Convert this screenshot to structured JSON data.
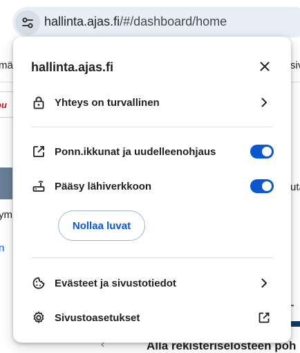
{
  "address_bar": {
    "url_host": "hallinta.ajas.fi",
    "url_rest": "/#/dashboard/home",
    "site_info_icon": "tune-icon"
  },
  "background_page": {
    "nav_left": "mä",
    "nav_right": "siv",
    "text_ym": "ym",
    "text_n": "n",
    "text_uta": "uta",
    "text_T": "T",
    "bottom_heading": "Alla rekisteriselosteen poh",
    "prev_chevron": "‹"
  },
  "popup": {
    "title": "hallinta.ajas.fi",
    "close_icon": "close-icon",
    "connection": {
      "label": "Yhteys on turvallinen",
      "icon": "lock-icon"
    },
    "popups_redirects": {
      "label": "Ponn.ikkunat ja uudelleenohjaus",
      "icon": "open-external-icon",
      "enabled": true
    },
    "local_network": {
      "label": "Pääsy lähiverkkoon",
      "icon": "router-icon",
      "enabled": true
    },
    "reset_button": "Nollaa luvat",
    "cookies": {
      "label": "Evästeet ja sivustotiedot",
      "icon": "cookie-icon"
    },
    "site_settings": {
      "label": "Sivustoasetukset",
      "icon": "gear-icon"
    }
  },
  "colors": {
    "accent": "#0b57d0",
    "omnibox_bg": "#e9eef6",
    "divider": "#d8e3e3"
  }
}
